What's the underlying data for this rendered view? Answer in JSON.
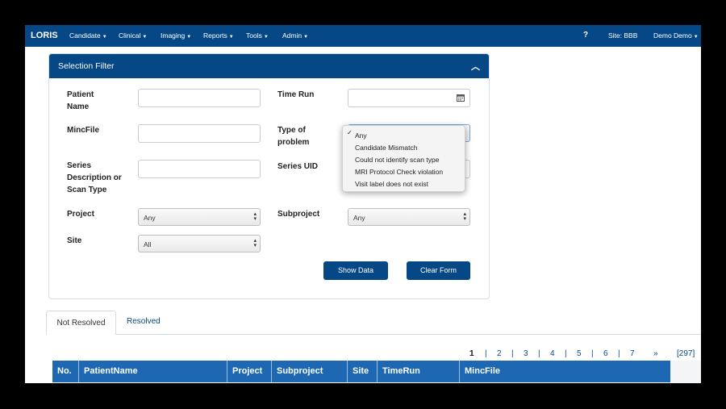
{
  "navbar": {
    "brand": "LORIS",
    "menus": [
      {
        "label": "Candidate"
      },
      {
        "label": "Clinical"
      },
      {
        "label": "Imaging"
      },
      {
        "label": "Reports"
      },
      {
        "label": "Tools"
      },
      {
        "label": "Admin"
      }
    ],
    "help": "?",
    "site": "Site: BBB",
    "user": "Demo Demo"
  },
  "filter": {
    "title": "Selection Filter",
    "fields": {
      "patient_name": {
        "label": "Patient Name",
        "value": ""
      },
      "time_run": {
        "label": "Time Run",
        "value": ""
      },
      "minc_file": {
        "label": "MincFile",
        "value": ""
      },
      "type_of_problem": {
        "label": "Type of problem",
        "value": "Any"
      },
      "series_desc": {
        "label": "Series Description or Scan Type",
        "value": ""
      },
      "series_uid": {
        "label": "Series UID",
        "value": ""
      },
      "project": {
        "label": "Project",
        "value": "Any"
      },
      "subproject": {
        "label": "Subproject",
        "value": "Any"
      },
      "site": {
        "label": "Site",
        "value": "All"
      }
    },
    "show_data": "Show Data",
    "clear_form": "Clear Form"
  },
  "problem_menu": {
    "check_mark": "✓",
    "options": [
      "Any",
      "Candidate Mismatch",
      "Could not identify scan type",
      "MRI Protocol Check violation",
      "Visit label does not exist"
    ]
  },
  "tabs": [
    {
      "label": "Not Resolved"
    },
    {
      "label": "Resolved"
    }
  ],
  "pagination": {
    "pages": [
      "1",
      "2",
      "3",
      "4",
      "5",
      "6",
      "7"
    ],
    "next": "»",
    "last": "[297]",
    "separator": "|"
  },
  "table": {
    "columns": [
      "No.",
      "PatientName",
      "Project",
      "Subproject",
      "Site",
      "TimeRun",
      "MincFile"
    ]
  }
}
